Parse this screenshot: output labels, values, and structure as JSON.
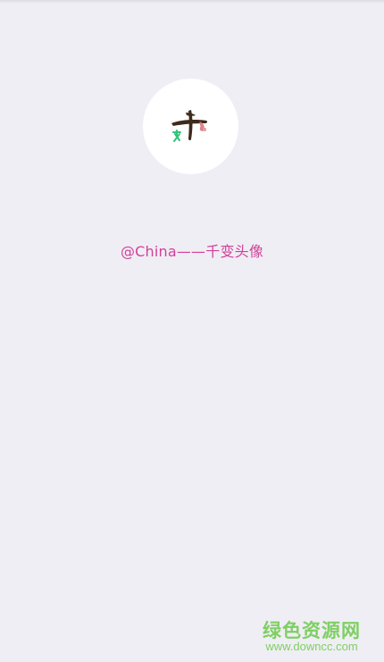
{
  "avatar": {
    "logo_text": "千变"
  },
  "caption": "@China——千变头像",
  "watermark": {
    "title": "绿色资源网",
    "url": "www.downcc.com"
  }
}
